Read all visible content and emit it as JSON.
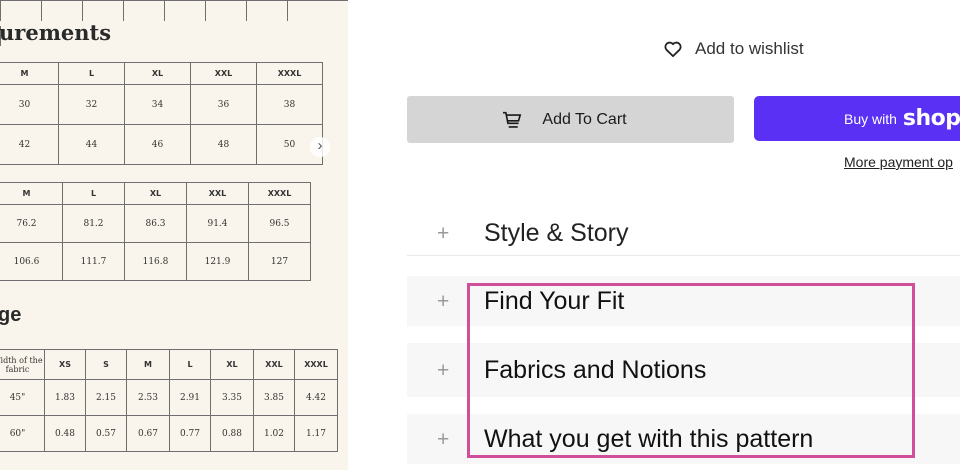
{
  "size_chart": {
    "heading_measurements": "urements",
    "heading_yardage": "ge",
    "inches_table": {
      "headers": [
        "M",
        "L",
        "XL",
        "XXL",
        "XXXL"
      ],
      "rows": [
        [
          "30",
          "32",
          "34",
          "36",
          "38"
        ],
        [
          "42",
          "44",
          "46",
          "48",
          "50"
        ]
      ]
    },
    "cm_table": {
      "headers": [
        "M",
        "L",
        "XL",
        "XXL",
        "XXXL"
      ],
      "rows": [
        [
          "76.2",
          "81.2",
          "86.3",
          "91.4",
          "96.5"
        ],
        [
          "106.6",
          "111.7",
          "116.8",
          "121.9",
          "127"
        ]
      ]
    },
    "yardage_table": {
      "headers": [
        "Width of the fabric",
        "XS",
        "S",
        "M",
        "L",
        "XL",
        "XXL",
        "XXXL"
      ],
      "rows": [
        [
          "45\"",
          "1.83",
          "2.15",
          "2.53",
          "2.91",
          "3.35",
          "3.85",
          "4.42"
        ],
        [
          "60\"",
          "0.48",
          "0.57",
          "0.67",
          "0.77",
          "0.88",
          "1.02",
          "1.17"
        ]
      ]
    },
    "next_arrow": "›"
  },
  "wishlist": {
    "label": "Add to wishlist",
    "icon": "heart-outline-icon"
  },
  "add_to_cart": {
    "label": "Add To Cart",
    "icon": "cart-icon"
  },
  "buy_with_shop": {
    "prefix": "Buy with",
    "brand": "shop",
    "color": "#5a31f4"
  },
  "more_payment": {
    "label": "More payment op"
  },
  "accordion": [
    {
      "label": "Style & Story",
      "icon": "plus-icon"
    },
    {
      "label": "Find Your Fit",
      "icon": "plus-icon"
    },
    {
      "label": "Fabrics and Notions",
      "icon": "plus-icon"
    },
    {
      "label": "What you get with this pattern",
      "icon": "plus-icon"
    }
  ],
  "highlight_color": "#d04f9a"
}
